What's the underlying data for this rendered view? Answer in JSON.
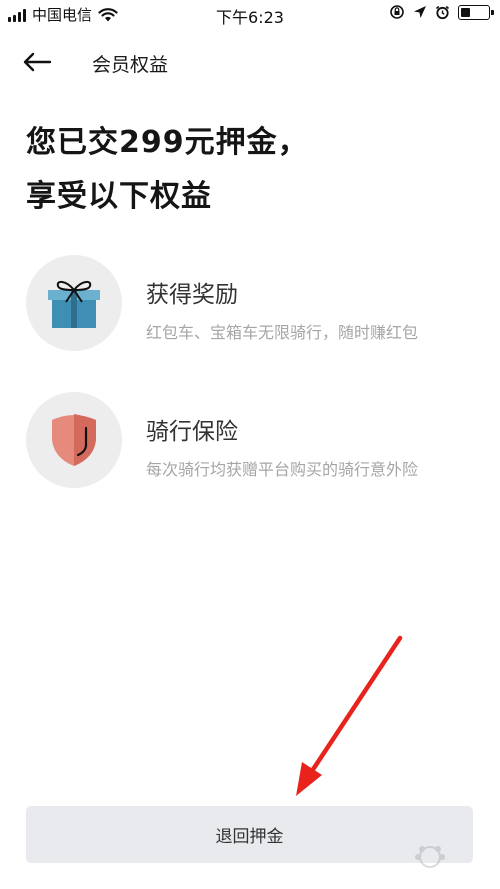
{
  "status_bar": {
    "carrier": "中国电信",
    "time": "下午6:23"
  },
  "nav": {
    "title": "会员权益"
  },
  "headline": {
    "line1": "您已交299元押金，",
    "line2": "享受以下权益"
  },
  "benefits": [
    {
      "icon": "gift-icon",
      "title": "获得奖励",
      "desc": "红包车、宝箱车无限骑行，随时赚红包"
    },
    {
      "icon": "shield-icon",
      "title": "骑行保险",
      "desc": "每次骑行均获赠平台购买的骑行意外险"
    }
  ],
  "refund_button": {
    "label": "退回押金"
  },
  "colors": {
    "annotation_arrow": "#e8231b",
    "button_bg": "#e8eaee",
    "icon_bg": "#ededed",
    "gift": "#3f8fb4",
    "shield": "#e58a7d"
  }
}
